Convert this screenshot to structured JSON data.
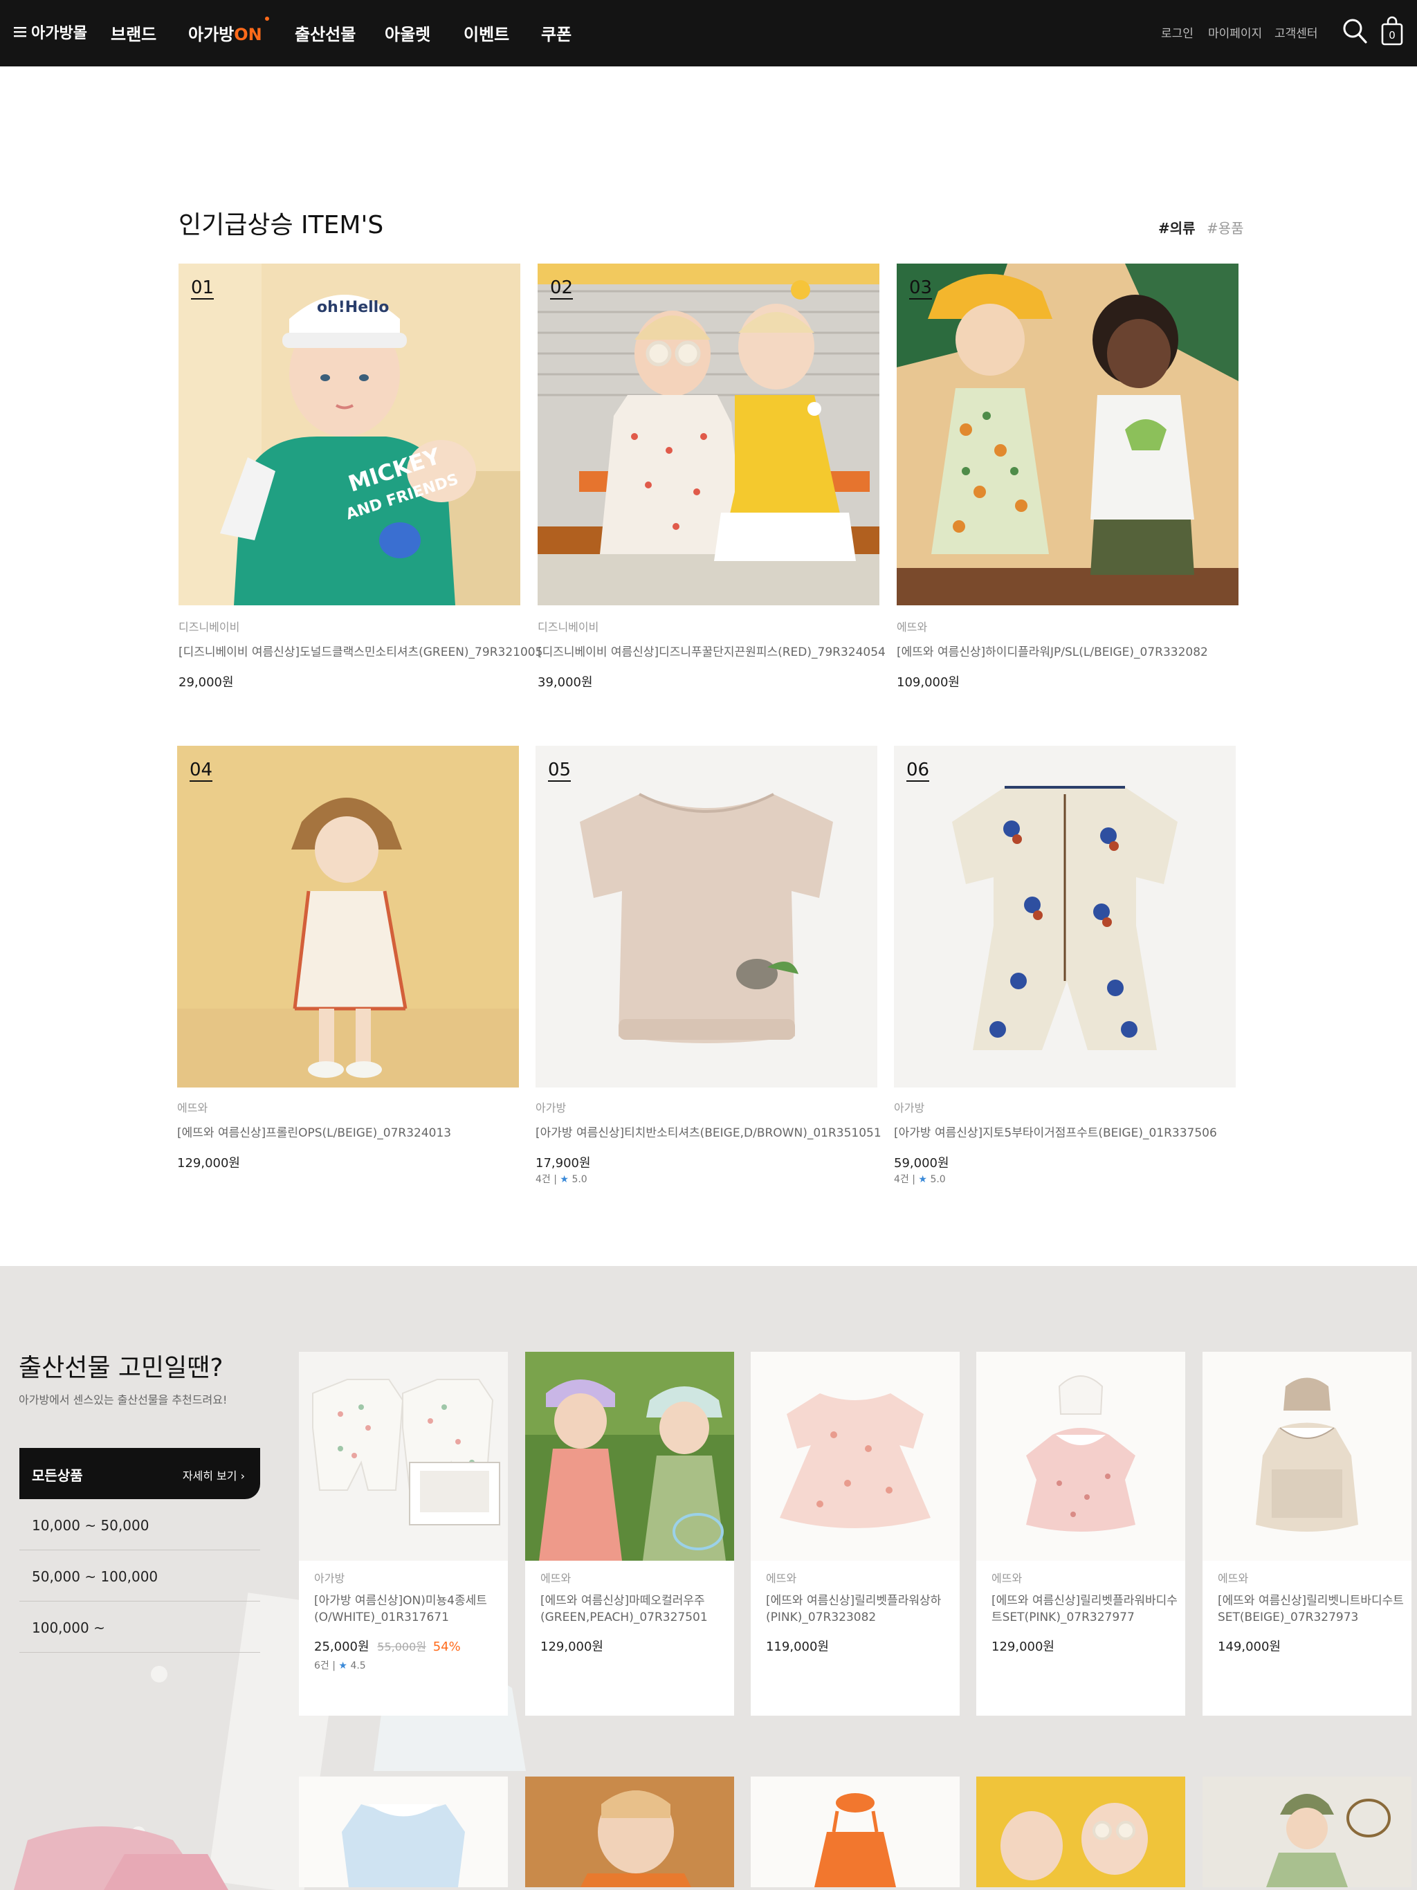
{
  "nav": {
    "menu_label": "아가방몰",
    "items": [
      "브랜드",
      "아가방",
      "ON",
      "출산선물",
      "아울렛",
      "이벤트",
      "쿠폰"
    ],
    "util": [
      "로그인",
      "마이페이지",
      "고객센터"
    ],
    "cart_count": "0",
    "icons": [
      "hamburger-icon",
      "search-icon",
      "shopping-bag-icon"
    ]
  },
  "popular": {
    "title": "인기급상승 ITEM'S",
    "tags": [
      "#의류",
      "#용품"
    ],
    "products": [
      {
        "rank": "01",
        "brand": "디즈니베이비",
        "name": "[디즈니베이비 여름신상]도널드클랙스민소티셔츠(GREEN)_79R321005",
        "price": "29,000원",
        "reviews": "",
        "rating": ""
      },
      {
        "rank": "02",
        "brand": "디즈니베이비",
        "name": "[디즈니베이비 여름신상]디즈니푸꿀단지끈원피스(RED)_79R324054",
        "price": "39,000원",
        "reviews": "",
        "rating": ""
      },
      {
        "rank": "03",
        "brand": "에뜨와",
        "name": "[에뜨와 여름신상]하이디플라워JP/SL(L/BEIGE)_07R332082",
        "price": "109,000원",
        "reviews": "",
        "rating": ""
      },
      {
        "rank": "04",
        "brand": "에뜨와",
        "name": "[에뜨와 여름신상]프롤린OPS(L/BEIGE)_07R324013",
        "price": "129,000원",
        "reviews": "",
        "rating": ""
      },
      {
        "rank": "05",
        "brand": "아가방",
        "name": "[아가방 여름신상]티치반소티셔츠(BEIGE,D/BROWN)_01R351051",
        "price": "17,900원",
        "reviews": "4건",
        "rating": "5.0"
      },
      {
        "rank": "06",
        "brand": "아가방",
        "name": "[아가방 여름신상]지토5부타이거점프수트(BEIGE)_01R337506",
        "price": "59,000원",
        "reviews": "4건",
        "rating": "5.0"
      }
    ]
  },
  "gift": {
    "title": "출산선물 고민일땐?",
    "subtitle": "아가방에서 센스있는 출산선물을 추천드려요!",
    "active_filter": "모든상품",
    "more_label": "자세히 보기",
    "ranges": [
      "10,000 ~ 50,000",
      "50,000 ~ 100,000",
      "100,000 ~"
    ],
    "products": [
      {
        "brand": "아가방",
        "name": "[아가방 여름신상]ON)미뇽4종세트(O/WHITE)_01R317671",
        "price": "25,000원",
        "orig_price": "55,000원",
        "discount": "54%",
        "reviews": "6건",
        "rating": "4.5"
      },
      {
        "brand": "에뜨와",
        "name": "[에뜨와 여름신상]마떼오컬러우주(GREEN,PEACH)_07R327501",
        "price": "129,000원",
        "orig_price": "",
        "discount": "",
        "reviews": "",
        "rating": ""
      },
      {
        "brand": "에뜨와",
        "name": "[에뜨와 여름신상]릴리벳플라워상하(PINK)_07R323082",
        "price": "119,000원",
        "orig_price": "",
        "discount": "",
        "reviews": "",
        "rating": ""
      },
      {
        "brand": "에뜨와",
        "name": "[에뜨와 여름신상]릴리벳플라워바디수트SET(PINK)_07R327977",
        "price": "129,000원",
        "orig_price": "",
        "discount": "",
        "reviews": "",
        "rating": ""
      },
      {
        "brand": "에뜨와",
        "name": "[에뜨와 여름신상]릴리벳니트바디수트SET(BEIGE)_07R327973",
        "price": "149,000원",
        "orig_price": "",
        "discount": "",
        "reviews": "",
        "rating": ""
      }
    ]
  },
  "colors": {
    "nav_bg": "#141414",
    "accent_orange": "#ff6a1a",
    "star_blue": "#3a89d8",
    "gift_bg": "#e6e4e2"
  }
}
